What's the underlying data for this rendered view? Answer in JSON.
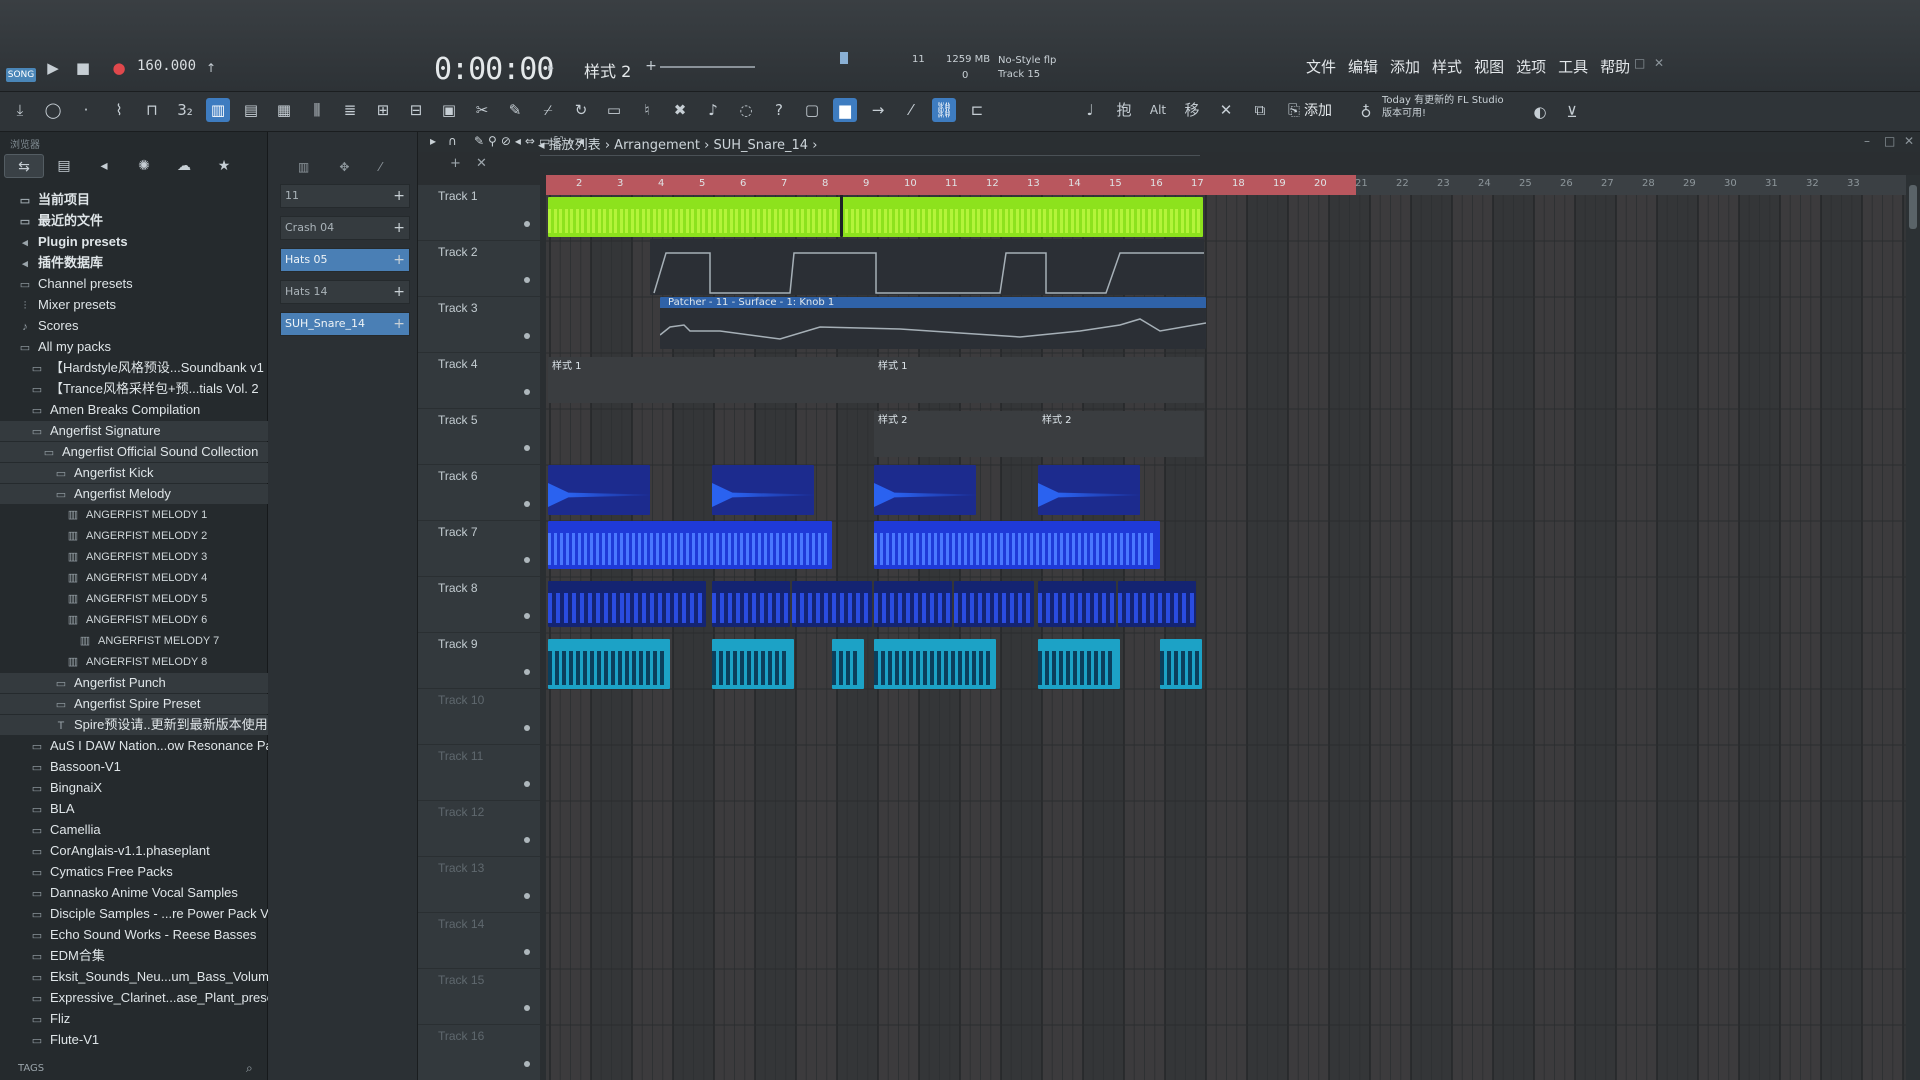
{
  "transport": {
    "song_tag": "SONG",
    "tempo": "160.000",
    "time": "0:00:00",
    "pattern": "样式 2",
    "cpu": "11",
    "memory": "1259 MB",
    "memory_sub": "0",
    "hint_title": "No-Style flp",
    "hint_sub": "Track 15"
  },
  "menu": [
    "文件",
    "编辑",
    "添加",
    "样式",
    "视图",
    "选项",
    "工具",
    "帮助"
  ],
  "toolbar": {
    "add_label": "添加",
    "news_line1": "Today 有更新的 FL Studio",
    "news_line2": "版本可用!"
  },
  "browser": {
    "header": "浏览器",
    "tags_label": "TAGS",
    "items": [
      {
        "label": "当前项目",
        "icon": "folder",
        "level": 0,
        "style": "bold"
      },
      {
        "label": "最近的文件",
        "icon": "folder",
        "level": 0,
        "style": "bold"
      },
      {
        "label": "Plugin presets",
        "icon": "plug",
        "level": 0,
        "style": "bold"
      },
      {
        "label": "插件数据库",
        "icon": "plug",
        "level": 0,
        "style": "bold"
      },
      {
        "label": "Channel presets",
        "icon": "folder",
        "level": 0,
        "style": ""
      },
      {
        "label": "Mixer presets",
        "icon": "mixer",
        "level": 0,
        "style": ""
      },
      {
        "label": "Scores",
        "icon": "note",
        "level": 0,
        "style": ""
      },
      {
        "label": "All my packs",
        "icon": "folder",
        "level": 0,
        "style": ""
      },
      {
        "label": "【Hardstyle风格预设...Soundbank v1",
        "icon": "folder",
        "level": 1,
        "style": ""
      },
      {
        "label": "【Trance风格采样包+预...tials Vol. 2",
        "icon": "folder",
        "level": 1,
        "style": ""
      },
      {
        "label": "Amen Breaks Compilation",
        "icon": "folder",
        "level": 1,
        "style": ""
      },
      {
        "label": "Angerfist Signature",
        "icon": "folder",
        "level": 1,
        "style": "sel"
      },
      {
        "label": "Angerfist Official Sound Collection",
        "icon": "folder",
        "level": 2,
        "style": "sel"
      },
      {
        "label": "Angerfist Kick",
        "icon": "folder",
        "level": 3,
        "style": "sel"
      },
      {
        "label": "Angerfist Melody",
        "icon": "folder",
        "level": 3,
        "style": "sel"
      },
      {
        "label": "ANGERFIST MELODY 1",
        "icon": "file",
        "level": 4,
        "style": "small"
      },
      {
        "label": "ANGERFIST MELODY 2",
        "icon": "file",
        "level": 4,
        "style": "small"
      },
      {
        "label": "ANGERFIST MELODY 3",
        "icon": "file",
        "level": 4,
        "style": "small"
      },
      {
        "label": "ANGERFIST MELODY 4",
        "icon": "file",
        "level": 4,
        "style": "small"
      },
      {
        "label": "ANGERFIST MELODY 5",
        "icon": "file",
        "level": 4,
        "style": "small"
      },
      {
        "label": "ANGERFIST MELODY 6",
        "icon": "file",
        "level": 4,
        "style": "small"
      },
      {
        "label": "ANGERFIST MELODY 7",
        "icon": "file",
        "level": 5,
        "style": "small"
      },
      {
        "label": "ANGERFIST MELODY 8",
        "icon": "file",
        "level": 4,
        "style": "small"
      },
      {
        "label": "Angerfist Punch",
        "icon": "folder",
        "level": 3,
        "style": "sel"
      },
      {
        "label": "Angerfist Spire Preset",
        "icon": "folder",
        "level": 3,
        "style": "sel"
      },
      {
        "label": "Spire预设请..更新到最新版本使用",
        "icon": "text",
        "level": 3,
        "style": "sel"
      },
      {
        "label": "AuS I DAW Nation...ow Resonance Pack",
        "icon": "folder",
        "level": 1,
        "style": ""
      },
      {
        "label": "Bassoon-V1",
        "icon": "folder",
        "level": 1,
        "style": ""
      },
      {
        "label": "BingnaiX",
        "icon": "folder",
        "level": 1,
        "style": ""
      },
      {
        "label": "BLA",
        "icon": "folder",
        "level": 1,
        "style": ""
      },
      {
        "label": "Camellia",
        "icon": "folder",
        "level": 1,
        "style": ""
      },
      {
        "label": "CorAnglais-v1.1.phaseplant",
        "icon": "folder",
        "level": 1,
        "style": ""
      },
      {
        "label": "Cymatics Free Packs",
        "icon": "folder",
        "level": 1,
        "style": ""
      },
      {
        "label": "Dannasko Anime Vocal Samples",
        "icon": "folder",
        "level": 1,
        "style": ""
      },
      {
        "label": "Disciple Samples - ...re Power Pack Vol. 1",
        "icon": "folder",
        "level": 1,
        "style": ""
      },
      {
        "label": "Echo Sound Works - Reese Basses",
        "icon": "folder",
        "level": 1,
        "style": ""
      },
      {
        "label": "EDM合集",
        "icon": "folder",
        "level": 1,
        "style": ""
      },
      {
        "label": "Eksit_Sounds_Neu...um_Bass_Volume_1",
        "icon": "folder",
        "level": 1,
        "style": ""
      },
      {
        "label": "Expressive_Clarinet...ase_Plant_preset_)",
        "icon": "folder",
        "level": 1,
        "style": ""
      },
      {
        "label": "Fliz",
        "icon": "folder",
        "level": 1,
        "style": ""
      },
      {
        "label": "Flute-V1",
        "icon": "folder",
        "level": 1,
        "style": ""
      }
    ]
  },
  "picker": {
    "items": [
      {
        "label": "11",
        "selected": false
      },
      {
        "label": "Crash 04",
        "selected": false
      },
      {
        "label": "Hats 05",
        "selected": true
      },
      {
        "label": "Hats 14",
        "selected": false
      },
      {
        "label": "SUH_Snare_14",
        "selected": true
      }
    ]
  },
  "playlist": {
    "title": "播放列表",
    "crumb1": "Arrangement",
    "crumb2": "SUH_Snare_14",
    "bars": [
      "2",
      "3",
      "4",
      "5",
      "6",
      "7",
      "8",
      "9",
      "10",
      "11",
      "12",
      "13",
      "14",
      "15",
      "16",
      "17",
      "18",
      "19",
      "20",
      "21",
      "22",
      "23",
      "24",
      "25",
      "26",
      "27",
      "28",
      "29",
      "30",
      "31",
      "32",
      "33"
    ],
    "loop_end_bar": 20,
    "tracks": [
      "Track 1",
      "Track 2",
      "Track 3",
      "Track 4",
      "Track 5",
      "Track 6",
      "Track 7",
      "Track 8",
      "Track 9",
      "Track 10",
      "Track 11",
      "Track 12",
      "Track 13",
      "Track 14",
      "Track 15",
      "Track 16"
    ],
    "active_track_count": 9,
    "automation_label": "Patcher - 11 - Surface - 1: Knob 1",
    "pattern1_label": "样式 1",
    "pattern2_label": "样式 2"
  },
  "colors": {
    "accent": "#3e7cc0",
    "loop": "#b9575e",
    "green_clip": "#8de21d",
    "blue_clip": "#1f3ad8",
    "cyan_clip": "#1ca2c6"
  }
}
